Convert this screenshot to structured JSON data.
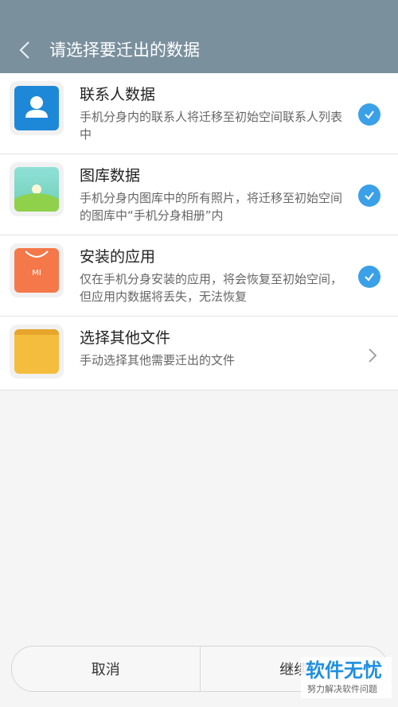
{
  "header": {
    "title": "请选择要迁出的数据"
  },
  "items": [
    {
      "title": "联系人数据",
      "desc": "手机分身内的联系人将迁移至初始空间联系人列表中",
      "selected": true,
      "icon": "contacts-icon",
      "color": "#1e88d8"
    },
    {
      "title": "图库数据",
      "desc": "手机分身内图库中的所有照片，将迁移至初始空间的图库中“手机分身相册”内",
      "selected": true,
      "icon": "gallery-icon",
      "color": "#7cd3c9"
    },
    {
      "title": "安装的应用",
      "desc": "仅在手机分身安装的应用，将会恢复至初始空间，但应用内数据将丢失，无法恢复",
      "selected": true,
      "icon": "app-store-icon",
      "color": "#f4784a"
    },
    {
      "title": "选择其他文件",
      "desc": "手动选择其他需要迁出的文件",
      "selected": false,
      "icon": "folder-icon",
      "color": "#f5bd3d"
    }
  ],
  "footer": {
    "cancel_label": "取消",
    "continue_label": "继续"
  },
  "watermark": {
    "main": "软件无忧",
    "sub": "努力解决软件问题"
  },
  "colors": {
    "header": "#7a909d",
    "accent": "#3aa0e8"
  }
}
